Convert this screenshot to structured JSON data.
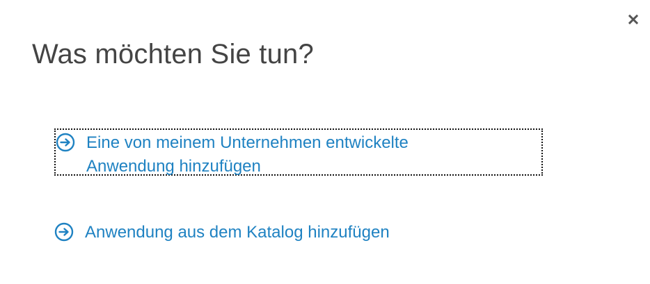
{
  "dialog": {
    "title": "Was möchten Sie tun?",
    "close_icon": "close-icon",
    "options": [
      {
        "label_line1": "Eine von meinem Unternehmen entwickelte",
        "label_line2": "Anwendung hinzufügen",
        "icon": "arrow-right-circle-icon",
        "focused": true
      },
      {
        "label": "Anwendung aus dem Katalog hinzufügen",
        "icon": "arrow-right-circle-icon",
        "focused": false
      }
    ]
  },
  "colors": {
    "title": "#444444",
    "link": "#1f82c2",
    "focus_outline": "#111111",
    "close": "#555555"
  }
}
